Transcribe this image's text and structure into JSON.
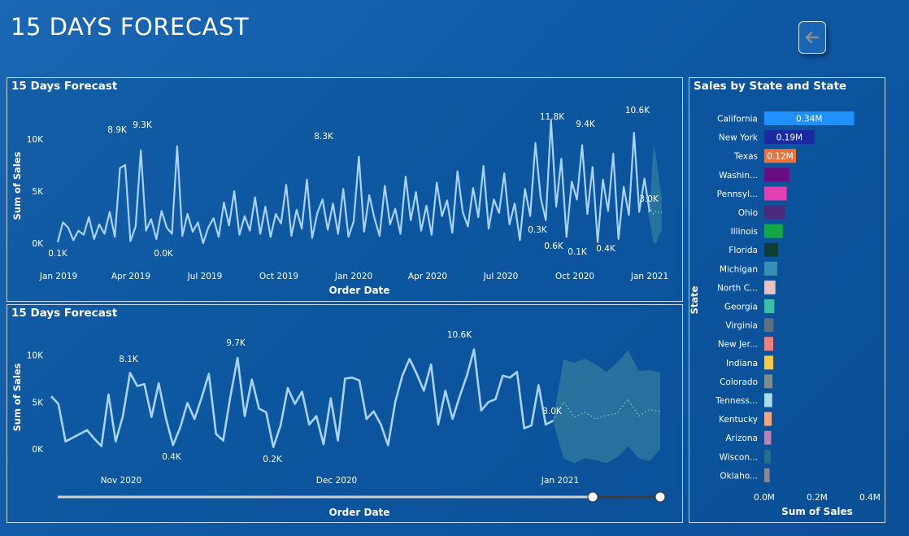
{
  "page": {
    "title": "15 DAYS FORECAST",
    "back_icon": "arrow-left-icon"
  },
  "chart_data": [
    {
      "type": "line",
      "title": "15 Days Forecast",
      "xlabel": "Order Date",
      "ylabel": "Sum of Sales",
      "y_ticks": [
        "10K",
        "5K",
        "0K"
      ],
      "x_ticks": [
        "Jan 2019",
        "Apr 2019",
        "Jul 2019",
        "Oct 2019",
        "Jan 2020",
        "Apr 2020",
        "Jul 2020",
        "Oct 2020",
        "Jan 2021"
      ],
      "ylim": [
        0,
        11000
      ],
      "forecast": true,
      "annotations": [
        "0.1K",
        "8.9K",
        "9.3K",
        "0.0K",
        "8.3K",
        "0.3K",
        "11.8K",
        "0.6K",
        "9.4K",
        "0.1K",
        "0.4K",
        "10.6K",
        "3.0K"
      ],
      "series": [
        {
          "values": [
            100,
            2000,
            1500,
            300,
            1200,
            800,
            2500,
            400,
            1800,
            900,
            3000,
            600,
            7200,
            7500,
            200,
            1600,
            8900,
            1200,
            2300,
            400,
            3100,
            1500,
            900,
            9300,
            700,
            2800,
            1100,
            2000,
            0,
            1500,
            2400,
            600,
            3900,
            1700,
            5000,
            800,
            2600,
            1200,
            4400,
            900,
            3500,
            600,
            2800,
            1900,
            5600,
            700,
            3200,
            1400,
            6100,
            500,
            2900,
            4200,
            1300,
            3800,
            900,
            5200,
            600,
            2100,
            8300,
            1100,
            4600,
            2400,
            700,
            5500,
            1800,
            3300,
            900,
            6400,
            2200,
            4900,
            1200,
            3600,
            800,
            5800,
            2600,
            4100,
            1000,
            6900,
            3000,
            1600,
            5300,
            2500,
            7400,
            1400,
            4200,
            2900,
            6700,
            1800,
            3800,
            300,
            5200,
            2600,
            9600,
            4400,
            2200,
            11800,
            3500,
            8100,
            600,
            5900,
            4200,
            9400,
            2800,
            7300,
            100,
            6100,
            3100,
            8600,
            400,
            5400,
            2700,
            10600,
            3000,
            6200,
            3000
          ]
        }
      ]
    },
    {
      "type": "line",
      "title": "15 Days Forecast",
      "xlabel": "Order Date",
      "ylabel": "Sum of Sales",
      "y_ticks": [
        "10K",
        "5K",
        "0K"
      ],
      "x_ticks": [
        "Nov 2020",
        "Dec 2020",
        "Jan 2021"
      ],
      "ylim": [
        0,
        11000
      ],
      "forecast": true,
      "annotations": [
        "8.1K",
        "0.4K",
        "9.7K",
        "0.2K",
        "10.6K",
        "3.0K"
      ],
      "series": [
        {
          "values": [
            5600,
            4800,
            800,
            1200,
            1600,
            2000,
            1100,
            300,
            5800,
            800,
            3500,
            8100,
            6700,
            6900,
            3400,
            7000,
            3300,
            400,
            2300,
            4900,
            3200,
            5500,
            8000,
            1600,
            900,
            5600,
            9700,
            3500,
            7400,
            4300,
            3900,
            200,
            2500,
            6500,
            4800,
            6100,
            2600,
            3500,
            500,
            5400,
            900,
            7500,
            7600,
            7300,
            3200,
            4000,
            2600,
            400,
            5000,
            7800,
            9600,
            8000,
            6200,
            9000,
            2600,
            6200,
            3200,
            5600,
            7800,
            10600,
            4100,
            5000,
            5300,
            7800,
            7600,
            8200,
            2200,
            2500,
            6800,
            2600,
            3000
          ]
        }
      ]
    },
    {
      "type": "bar",
      "title": "Sales by State and State",
      "xlabel": "Sum of Sales",
      "ylabel": "State",
      "x_ticks": [
        "0.0M",
        "0.2M",
        "0.4M"
      ],
      "xlim": [
        0,
        0.4
      ],
      "categories": [
        "California",
        "New York",
        "Texas",
        "Washin...",
        "Pennsyl...",
        "Ohio",
        "Illinois",
        "Florida",
        "Michigan",
        "North C...",
        "Georgia",
        "Virginia",
        "New Jer...",
        "Indiana",
        "Colorado",
        "Tenness...",
        "Kentucky",
        "Arizona",
        "Wiscon...",
        "Oklaho..."
      ],
      "values": [
        0.34,
        0.19,
        0.12,
        0.095,
        0.085,
        0.078,
        0.07,
        0.052,
        0.049,
        0.042,
        0.038,
        0.035,
        0.034,
        0.034,
        0.031,
        0.03,
        0.028,
        0.026,
        0.024,
        0.02
      ],
      "bar_labels": [
        "0.34M",
        "0.19M",
        "0.12M",
        "",
        "",
        "",
        "",
        "",
        "",
        "",
        "",
        "",
        "",
        "",
        "",
        "",
        "",
        "",
        "",
        ""
      ],
      "colors": [
        "#1e90ff",
        "#1a2aa0",
        "#e8743b",
        "#6a0d83",
        "#e040b0",
        "#4a2a7a",
        "#12a84a",
        "#0e3f3a",
        "#3a8fb7",
        "#e6c3c3",
        "#3bbfa8",
        "#5a7080",
        "#f08080",
        "#f2c94c",
        "#7f8c8d",
        "#a6dcef",
        "#f4a582",
        "#b784b7",
        "#2a6f8a",
        "#8a8a95"
      ]
    }
  ]
}
